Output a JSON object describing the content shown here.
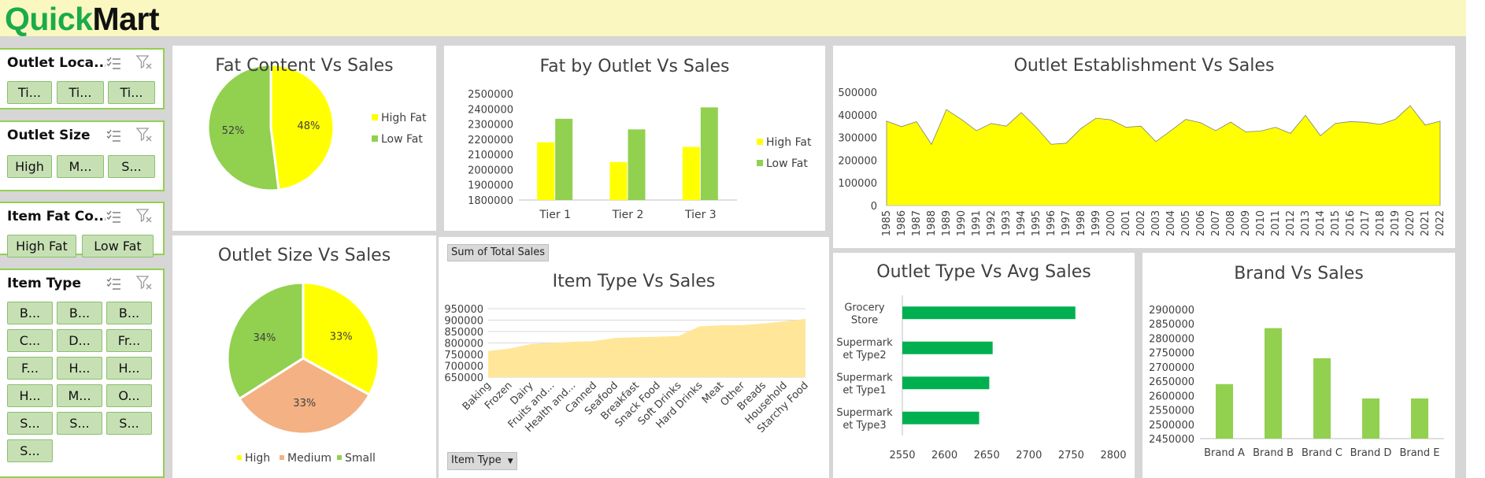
{
  "app": {
    "logo_part1": "Quick",
    "logo_part2": "Mart"
  },
  "colors": {
    "high_fat": "#ffff00",
    "low_fat": "#92d050",
    "medium": "#f4b183",
    "item_area": "#ffe699",
    "outlet_bar": "#00b050",
    "slicer_button": "#c6e0b4"
  },
  "slicers": [
    {
      "title": "Outlet Loca...",
      "items": [
        "Ti...",
        "Ti...",
        "Ti..."
      ]
    },
    {
      "title": "Outlet Size",
      "items": [
        "High",
        "M...",
        "S..."
      ]
    },
    {
      "title": "Item Fat Co...",
      "items": [
        "High Fat",
        "Low Fat"
      ]
    },
    {
      "title": "Item Type",
      "items": [
        "B...",
        "B...",
        "B...",
        "C...",
        "D...",
        "Fr...",
        "F...",
        "H...",
        "H...",
        "H...",
        "M...",
        "O...",
        "S...",
        "S...",
        "S...",
        "S..."
      ]
    }
  ],
  "slicer_icons": {
    "multi_select": "multi-select-icon",
    "clear_filter": "clear-filter-icon"
  },
  "charts": {
    "fat_content": {
      "title": "Fat Content Vs Sales"
    },
    "fat_outlet": {
      "title": "Fat by Outlet Vs Sales"
    },
    "establishment": {
      "title": "Outlet Establishment Vs Sales"
    },
    "outlet_size": {
      "title": "Outlet Size Vs Sales"
    },
    "item_type": {
      "title": "Item Type Vs Sales",
      "value_button": "Sum of Total Sales",
      "axis_button": "Item Type"
    },
    "outlet_type": {
      "title": "Outlet Type Vs Avg Sales"
    },
    "brand": {
      "title": "Brand Vs Sales"
    }
  },
  "chart_data": [
    {
      "id": "fat_content",
      "type": "pie",
      "title": "Fat Content Vs Sales",
      "labels": [
        "High Fat",
        "Low Fat"
      ],
      "values": [
        48,
        52
      ],
      "data_labels": [
        "48%",
        "52%"
      ],
      "legend": "right"
    },
    {
      "id": "fat_outlet",
      "type": "bar",
      "title": "Fat by Outlet Vs Sales",
      "categories": [
        "Tier 1",
        "Tier 2",
        "Tier 3"
      ],
      "series": [
        {
          "name": "High Fat",
          "values": [
            2180000,
            2050000,
            2150000
          ]
        },
        {
          "name": "Low Fat",
          "values": [
            2335000,
            2265000,
            2410000
          ]
        }
      ],
      "ylim": [
        1800000,
        2500000
      ],
      "yticks": [
        1800000,
        1900000,
        2000000,
        2100000,
        2200000,
        2300000,
        2400000,
        2500000
      ],
      "legend": "right"
    },
    {
      "id": "establishment",
      "type": "area",
      "title": "Outlet Establishment Vs Sales",
      "x": [
        "1985",
        "1986",
        "1987",
        "1988",
        "1989",
        "1990",
        "1991",
        "1992",
        "1993",
        "1994",
        "1995",
        "1996",
        "1997",
        "1998",
        "1999",
        "2000",
        "2001",
        "2002",
        "2003",
        "2004",
        "2005",
        "2006",
        "2007",
        "2008",
        "2009",
        "2010",
        "2011",
        "2012",
        "2013",
        "2014",
        "2015",
        "2016",
        "2017",
        "2018",
        "2019",
        "2020",
        "2021",
        "2022"
      ],
      "values": [
        372000,
        348000,
        370000,
        270000,
        423000,
        380000,
        330000,
        362000,
        350000,
        410000,
        345000,
        270000,
        275000,
        340000,
        385000,
        378000,
        345000,
        350000,
        282000,
        330000,
        380000,
        365000,
        330000,
        368000,
        325000,
        328000,
        345000,
        318000,
        398000,
        308000,
        362000,
        370000,
        367000,
        358000,
        380000,
        440000,
        355000,
        372000
      ],
      "ylim": [
        0,
        500000
      ],
      "yticks": [
        0,
        100000,
        200000,
        300000,
        400000,
        500000
      ]
    },
    {
      "id": "outlet_size",
      "type": "pie",
      "title": "Outlet Size Vs Sales",
      "labels": [
        "High",
        "Medium",
        "Small"
      ],
      "values": [
        33,
        33,
        34
      ],
      "data_labels": [
        "33%",
        "33%",
        "34%"
      ],
      "legend": "bottom"
    },
    {
      "id": "item_type",
      "type": "area",
      "title": "Item Type Vs Sales",
      "categories": [
        "Baking",
        "Frozen",
        "Dairy",
        "Fruits and...",
        "Health and...",
        "Canned",
        "Seafood",
        "Breakfast",
        "Snack Food",
        "Soft Drinks",
        "Hard Drinks",
        "Meat",
        "Other",
        "Breads",
        "Household",
        "Starchy Food"
      ],
      "values": [
        765000,
        775000,
        795000,
        800000,
        805000,
        808000,
        822000,
        825000,
        827000,
        830000,
        873000,
        877000,
        878000,
        885000,
        895000,
        905000
      ],
      "ylim": [
        650000,
        950000
      ],
      "yticks": [
        650000,
        700000,
        750000,
        800000,
        850000,
        900000,
        950000
      ]
    },
    {
      "id": "outlet_type",
      "type": "bar",
      "orientation": "horizontal",
      "title": "Outlet Type Vs Avg Sales",
      "categories": [
        "Grocery Store",
        "Supermarket Type2",
        "Supermarket Type1",
        "Supermarket Type3"
      ],
      "category_lines": [
        [
          "Grocery",
          "Store"
        ],
        [
          "Supermark",
          "et Type2"
        ],
        [
          "Supermark",
          "et Type1"
        ],
        [
          "Supermark",
          "et Type3"
        ]
      ],
      "values": [
        2755,
        2657,
        2653,
        2641
      ],
      "xlim": [
        2550,
        2800
      ],
      "xticks": [
        2550,
        2600,
        2650,
        2700,
        2750,
        2800
      ]
    },
    {
      "id": "brand",
      "type": "bar",
      "title": "Brand Vs Sales",
      "categories": [
        "Brand A",
        "Brand B",
        "Brand C",
        "Brand D",
        "Brand E"
      ],
      "values": [
        2640000,
        2835000,
        2730000,
        2590000,
        2590000
      ],
      "ylim": [
        2450000,
        2900000
      ],
      "yticks": [
        2450000,
        2500000,
        2550000,
        2600000,
        2650000,
        2700000,
        2750000,
        2800000,
        2850000,
        2900000
      ]
    }
  ]
}
